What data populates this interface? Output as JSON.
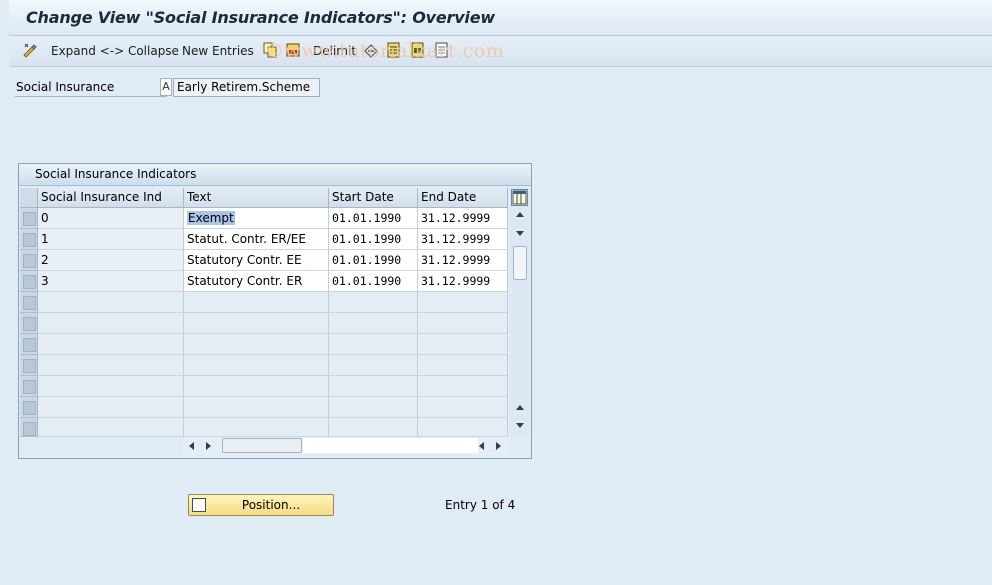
{
  "window": {
    "title": "Change View \"Social Insurance Indicators\": Overview"
  },
  "toolbar": {
    "expand_collapse": "Expand <-> Collapse",
    "new_entries": "New Entries",
    "delimit": "Delimit"
  },
  "watermark": "©www.tutorialkart.com",
  "header_field": {
    "label": "Social Insurance",
    "indicator": "A",
    "value": "Early Retirem.Scheme"
  },
  "table": {
    "caption": "Social Insurance Indicators",
    "columns": [
      "Social Insurance Ind",
      "Text",
      "Start Date",
      "End Date"
    ],
    "rows": [
      {
        "ind": "0",
        "text": "Exempt",
        "start": "01.01.1990",
        "end": "31.12.9999"
      },
      {
        "ind": "1",
        "text": "Statut. Contr. ER/EE",
        "start": "01.01.1990",
        "end": "31.12.9999"
      },
      {
        "ind": "2",
        "text": "Statutory Contr. EE",
        "start": "01.01.1990",
        "end": "31.12.9999"
      },
      {
        "ind": "3",
        "text": "Statutory Contr. ER",
        "start": "01.01.1990",
        "end": "31.12.9999"
      }
    ]
  },
  "footer": {
    "position_button": "Position...",
    "entry_info": "Entry 1 of 4"
  }
}
